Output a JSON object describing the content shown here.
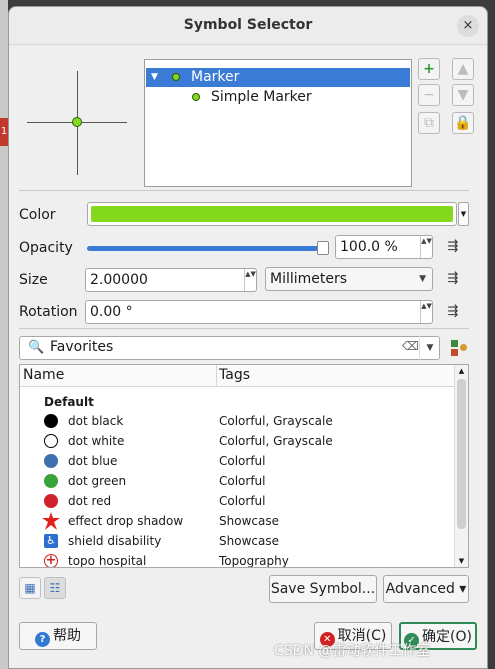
{
  "window": {
    "title": "Symbol Selector",
    "close_glyph": "×"
  },
  "background": {
    "side_label": "1"
  },
  "layer_tree": {
    "expand_glyph": "▼",
    "items": [
      {
        "label": "Marker",
        "selected": true
      },
      {
        "label": "Simple Marker",
        "selected": false
      }
    ]
  },
  "layer_buttons": {
    "add_glyph": "+",
    "remove_glyph": "−",
    "duplicate_glyph": "⧉",
    "move_up_glyph": "▲",
    "move_down_glyph": "▼",
    "lock_glyph": "🔒"
  },
  "properties": {
    "color": {
      "label": "Color",
      "value_hex": "#84d81e"
    },
    "opacity": {
      "label": "Opacity",
      "value": "100.0 %",
      "level": 1.0
    },
    "size": {
      "label": "Size",
      "value": "2.00000",
      "unit": "Millimeters"
    },
    "rotation": {
      "label": "Rotation",
      "value": "0.00 °"
    },
    "dd_glyph": "⇶",
    "spin_glyph": "▲▼"
  },
  "search": {
    "icon": "search-icon",
    "glyph": "🔍",
    "value": "Favorites",
    "clear_glyph": "⌫",
    "dropdown_glyph": "▼"
  },
  "symbol_table": {
    "columns": [
      "Name",
      "Tags"
    ],
    "group": "Default",
    "rows": [
      {
        "name": "dot  black",
        "tags": "Colorful, Grayscale",
        "symbol": "filled-black",
        "color": "#000000"
      },
      {
        "name": "dot  white",
        "tags": "Colorful, Grayscale",
        "symbol": "outline-white",
        "color": "#ffffff"
      },
      {
        "name": "dot blue",
        "tags": "Colorful",
        "symbol": "filled-blue",
        "color": "#3e6fb0"
      },
      {
        "name": "dot green",
        "tags": "Colorful",
        "symbol": "filled-green",
        "color": "#3aa23a"
      },
      {
        "name": "dot red",
        "tags": "Colorful",
        "symbol": "filled-red",
        "color": "#d0202a"
      },
      {
        "name": "effect drop shadow",
        "tags": "Showcase",
        "symbol": "red-star",
        "color": "#e3201b"
      },
      {
        "name": "shield disability",
        "tags": "Showcase",
        "symbol": "disability",
        "color": "#2b6fd0"
      },
      {
        "name": "topo hospital",
        "tags": "Topography",
        "symbol": "hospital-cross",
        "color": "#d02020"
      }
    ]
  },
  "footer": {
    "save_symbol": "Save Symbol...",
    "advanced": "Advanced",
    "advanced_arrow": "▾",
    "help": "帮助",
    "cancel": "取消(C)",
    "ok": "确定(O)",
    "help_glyph": "?",
    "cancel_glyph": "✕",
    "ok_glyph": "✓",
    "colors": {
      "help": "#2e7ad1",
      "cancel": "#d02020",
      "ok": "#2e8b57"
    }
  },
  "watermark": "CSDN @雷动软件工作室"
}
